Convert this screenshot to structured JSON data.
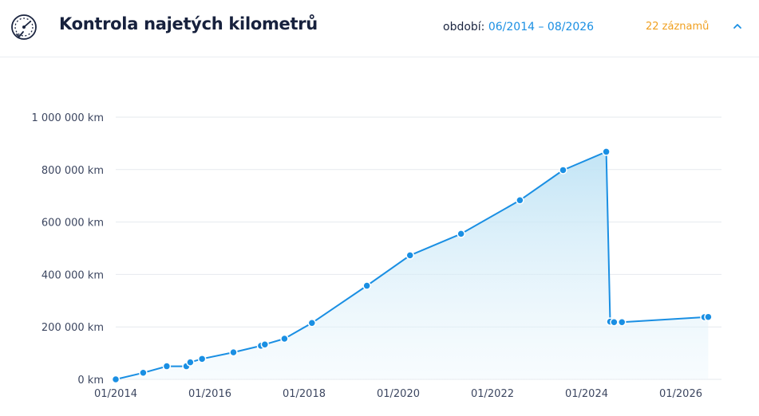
{
  "header": {
    "title": "Kontrola najetých kilometrů",
    "period_label": "období:",
    "period_value": "06/2014 – 08/2026",
    "records": "22 záznamů",
    "icon": "gauge-icon",
    "collapse_icon": "chevron-up-icon"
  },
  "colors": {
    "line": "#1a8fe3",
    "point": "#1a8fe3",
    "fill": "#d6eef9",
    "grid": "#e6e9ee",
    "records": "#f0a020",
    "period": "#1a8fe3"
  },
  "chart_data": {
    "type": "area",
    "ylim": [
      0,
      1000000
    ],
    "yticks": [
      0,
      200000,
      400000,
      600000,
      800000,
      1000000
    ],
    "ytick_labels": [
      "0 km",
      "200 000 km",
      "400 000 km",
      "600 000 km",
      "800 000 km",
      "1 000 000 km"
    ],
    "xticks": [
      "2014-01",
      "2016-01",
      "2018-01",
      "2020-01",
      "2022-01",
      "2024-01",
      "2026-01"
    ],
    "xtick_labels": [
      "01/2014",
      "01/2016",
      "01/2018",
      "01/2020",
      "01/2022",
      "01/2024",
      "01/2026"
    ],
    "grid": true,
    "series": [
      {
        "x": [
          "2014-01",
          "2014-08",
          "2015-02",
          "2015-07",
          "2015-08",
          "2015-11",
          "2016-07",
          "2017-02",
          "2017-03",
          "2017-08",
          "2018-03",
          "2019-05",
          "2020-04",
          "2021-05",
          "2022-08",
          "2023-07",
          "2024-06",
          "2024-07",
          "2024-08",
          "2024-10",
          "2026-07",
          "2026-08"
        ],
        "y": [
          0,
          25000,
          50000,
          50000,
          65000,
          78000,
          103000,
          128000,
          133000,
          155000,
          215000,
          357000,
          473000,
          555000,
          683000,
          798000,
          868000,
          220000,
          218000,
          218000,
          237000,
          238000
        ]
      }
    ]
  }
}
